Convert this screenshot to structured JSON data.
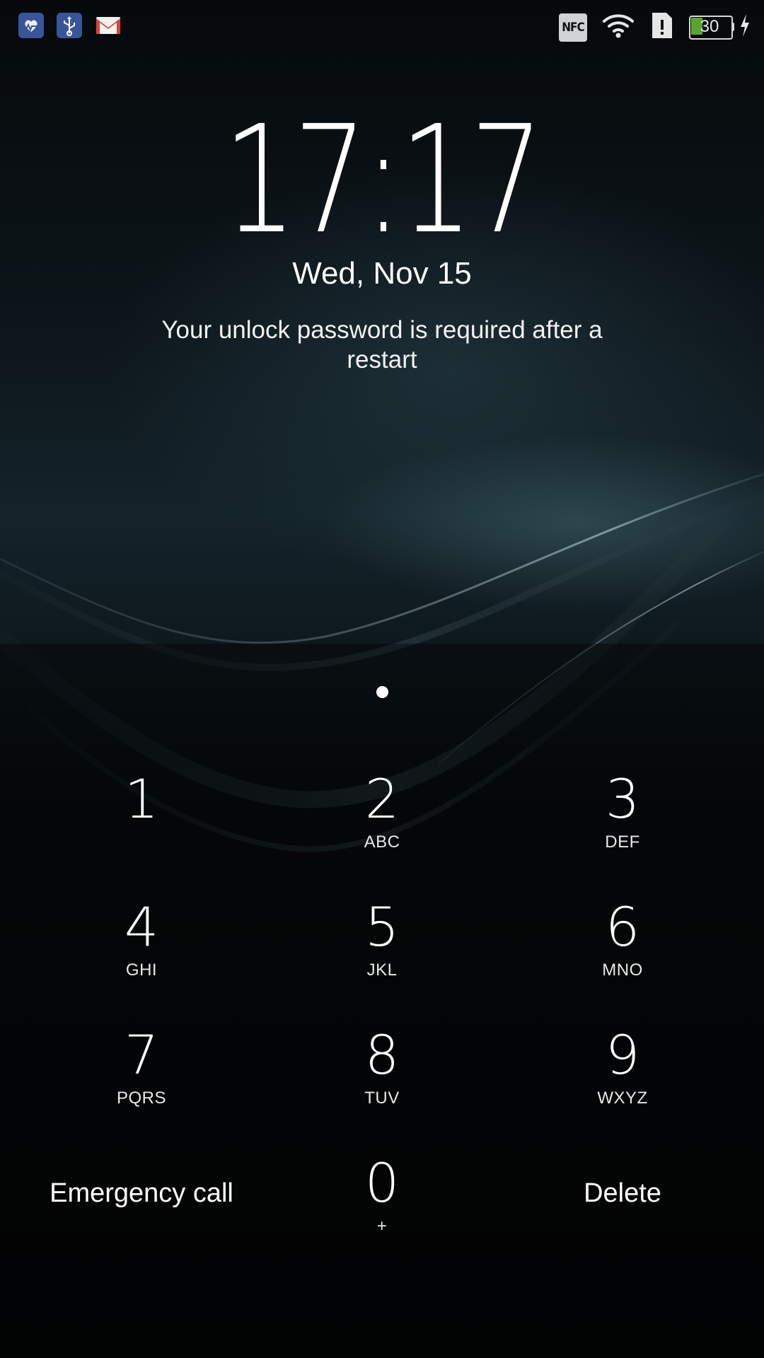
{
  "status_bar": {
    "left_icons": [
      "heart-rate-icon",
      "usb-icon",
      "gmail-icon"
    ],
    "right_icons": [
      "nfc-icon",
      "wifi-icon",
      "sim-alert-icon",
      "battery-icon",
      "charging-icon"
    ],
    "nfc_label": "NFC",
    "battery_level": "30",
    "colors": {
      "app_icon_bg": "#3a5499",
      "battery_fill": "#5aa532",
      "gmail_red": "#d44638"
    }
  },
  "lockscreen": {
    "time": "17:17",
    "date": "Wed, Nov 15",
    "message": "Your unlock password is required after a restart",
    "pin_dots_entered": 1
  },
  "keypad": {
    "keys": [
      {
        "digit": "1",
        "letters": ""
      },
      {
        "digit": "2",
        "letters": "ABC"
      },
      {
        "digit": "3",
        "letters": "DEF"
      },
      {
        "digit": "4",
        "letters": "GHI"
      },
      {
        "digit": "5",
        "letters": "JKL"
      },
      {
        "digit": "6",
        "letters": "MNO"
      },
      {
        "digit": "7",
        "letters": "PQRS"
      },
      {
        "digit": "8",
        "letters": "TUV"
      },
      {
        "digit": "9",
        "letters": "WXYZ"
      },
      {
        "digit": "0",
        "letters": "+"
      }
    ],
    "emergency_label": "Emergency call",
    "delete_label": "Delete"
  }
}
